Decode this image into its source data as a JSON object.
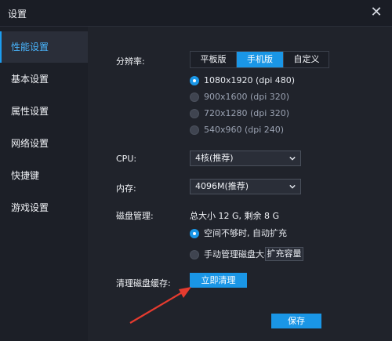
{
  "window": {
    "title": "设置",
    "close_glyph": "✕"
  },
  "sidebar": {
    "items": [
      {
        "label": "性能设置",
        "active": true
      },
      {
        "label": "基本设置",
        "active": false
      },
      {
        "label": "属性设置",
        "active": false
      },
      {
        "label": "网络设置",
        "active": false
      },
      {
        "label": "快捷键",
        "active": false
      },
      {
        "label": "游戏设置",
        "active": false
      }
    ]
  },
  "performance": {
    "resolution_label": "分辨率:",
    "resolution_tabs": [
      "平板版",
      "手机版",
      "自定义"
    ],
    "resolution_selected_tab": "手机版",
    "resolution_options": [
      {
        "label": "1080x1920 (dpi 480)",
        "checked": true
      },
      {
        "label": "900x1600 (dpi 320)",
        "checked": false
      },
      {
        "label": "720x1280 (dpi 320)",
        "checked": false
      },
      {
        "label": "540x960 (dpi 240)",
        "checked": false
      }
    ],
    "cpu_label": "CPU:",
    "cpu_value": "4核(推荐)",
    "memory_label": "内存:",
    "memory_value": "4096M(推荐)",
    "disk_label": "磁盘管理:",
    "disk_info": "总大小 12 G, 剩余 8 G",
    "disk_options": [
      {
        "label": "空间不够时, 自动扩充",
        "checked": true
      },
      {
        "label": "手动管理磁盘大小",
        "checked": false
      }
    ],
    "expand_capacity_button": "扩充容量",
    "clear_cache_label": "清理磁盘缓存:",
    "clear_now_button": "立即清理",
    "save_button": "保存"
  },
  "colors": {
    "accent": "#1a96e6",
    "arrow": "#e53b2f"
  }
}
